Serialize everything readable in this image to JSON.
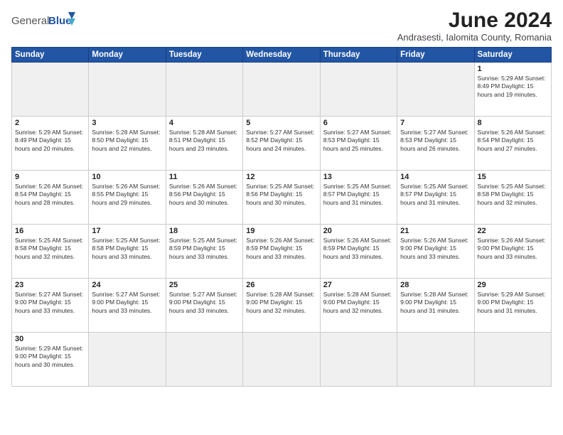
{
  "logo": {
    "text_general": "General",
    "text_blue": "Blue"
  },
  "header": {
    "month_year": "June 2024",
    "location": "Andrasesti, Ialomita County, Romania"
  },
  "days_of_week": [
    "Sunday",
    "Monday",
    "Tuesday",
    "Wednesday",
    "Thursday",
    "Friday",
    "Saturday"
  ],
  "weeks": [
    [
      {
        "day": "",
        "info": ""
      },
      {
        "day": "",
        "info": ""
      },
      {
        "day": "",
        "info": ""
      },
      {
        "day": "",
        "info": ""
      },
      {
        "day": "",
        "info": ""
      },
      {
        "day": "",
        "info": ""
      },
      {
        "day": "1",
        "info": "Sunrise: 5:29 AM\nSunset: 8:49 PM\nDaylight: 15 hours and 19 minutes."
      }
    ],
    [
      {
        "day": "2",
        "info": "Sunrise: 5:29 AM\nSunset: 8:49 PM\nDaylight: 15 hours and 20 minutes."
      },
      {
        "day": "3",
        "info": "Sunrise: 5:28 AM\nSunset: 8:50 PM\nDaylight: 15 hours and 22 minutes."
      },
      {
        "day": "4",
        "info": "Sunrise: 5:28 AM\nSunset: 8:51 PM\nDaylight: 15 hours and 23 minutes."
      },
      {
        "day": "5",
        "info": "Sunrise: 5:27 AM\nSunset: 8:52 PM\nDaylight: 15 hours and 24 minutes."
      },
      {
        "day": "6",
        "info": "Sunrise: 5:27 AM\nSunset: 8:53 PM\nDaylight: 15 hours and 25 minutes."
      },
      {
        "day": "7",
        "info": "Sunrise: 5:27 AM\nSunset: 8:53 PM\nDaylight: 15 hours and 26 minutes."
      },
      {
        "day": "8",
        "info": "Sunrise: 5:26 AM\nSunset: 8:54 PM\nDaylight: 15 hours and 27 minutes."
      }
    ],
    [
      {
        "day": "9",
        "info": "Sunrise: 5:26 AM\nSunset: 8:54 PM\nDaylight: 15 hours and 28 minutes."
      },
      {
        "day": "10",
        "info": "Sunrise: 5:26 AM\nSunset: 8:55 PM\nDaylight: 15 hours and 29 minutes."
      },
      {
        "day": "11",
        "info": "Sunrise: 5:26 AM\nSunset: 8:56 PM\nDaylight: 15 hours and 30 minutes."
      },
      {
        "day": "12",
        "info": "Sunrise: 5:25 AM\nSunset: 8:56 PM\nDaylight: 15 hours and 30 minutes."
      },
      {
        "day": "13",
        "info": "Sunrise: 5:25 AM\nSunset: 8:57 PM\nDaylight: 15 hours and 31 minutes."
      },
      {
        "day": "14",
        "info": "Sunrise: 5:25 AM\nSunset: 8:57 PM\nDaylight: 15 hours and 31 minutes."
      },
      {
        "day": "15",
        "info": "Sunrise: 5:25 AM\nSunset: 8:58 PM\nDaylight: 15 hours and 32 minutes."
      }
    ],
    [
      {
        "day": "16",
        "info": "Sunrise: 5:25 AM\nSunset: 8:58 PM\nDaylight: 15 hours and 32 minutes."
      },
      {
        "day": "17",
        "info": "Sunrise: 5:25 AM\nSunset: 8:58 PM\nDaylight: 15 hours and 33 minutes."
      },
      {
        "day": "18",
        "info": "Sunrise: 5:25 AM\nSunset: 8:59 PM\nDaylight: 15 hours and 33 minutes."
      },
      {
        "day": "19",
        "info": "Sunrise: 5:26 AM\nSunset: 8:59 PM\nDaylight: 15 hours and 33 minutes."
      },
      {
        "day": "20",
        "info": "Sunrise: 5:26 AM\nSunset: 8:59 PM\nDaylight: 15 hours and 33 minutes."
      },
      {
        "day": "21",
        "info": "Sunrise: 5:26 AM\nSunset: 9:00 PM\nDaylight: 15 hours and 33 minutes."
      },
      {
        "day": "22",
        "info": "Sunrise: 5:26 AM\nSunset: 9:00 PM\nDaylight: 15 hours and 33 minutes."
      }
    ],
    [
      {
        "day": "23",
        "info": "Sunrise: 5:27 AM\nSunset: 9:00 PM\nDaylight: 15 hours and 33 minutes."
      },
      {
        "day": "24",
        "info": "Sunrise: 5:27 AM\nSunset: 9:00 PM\nDaylight: 15 hours and 33 minutes."
      },
      {
        "day": "25",
        "info": "Sunrise: 5:27 AM\nSunset: 9:00 PM\nDaylight: 15 hours and 33 minutes."
      },
      {
        "day": "26",
        "info": "Sunrise: 5:28 AM\nSunset: 9:00 PM\nDaylight: 15 hours and 32 minutes."
      },
      {
        "day": "27",
        "info": "Sunrise: 5:28 AM\nSunset: 9:00 PM\nDaylight: 15 hours and 32 minutes."
      },
      {
        "day": "28",
        "info": "Sunrise: 5:28 AM\nSunset: 9:00 PM\nDaylight: 15 hours and 31 minutes."
      },
      {
        "day": "29",
        "info": "Sunrise: 5:29 AM\nSunset: 9:00 PM\nDaylight: 15 hours and 31 minutes."
      }
    ],
    [
      {
        "day": "30",
        "info": "Sunrise: 5:29 AM\nSunset: 9:00 PM\nDaylight: 15 hours and 30 minutes."
      },
      {
        "day": "",
        "info": ""
      },
      {
        "day": "",
        "info": ""
      },
      {
        "day": "",
        "info": ""
      },
      {
        "day": "",
        "info": ""
      },
      {
        "day": "",
        "info": ""
      },
      {
        "day": "",
        "info": ""
      }
    ]
  ]
}
